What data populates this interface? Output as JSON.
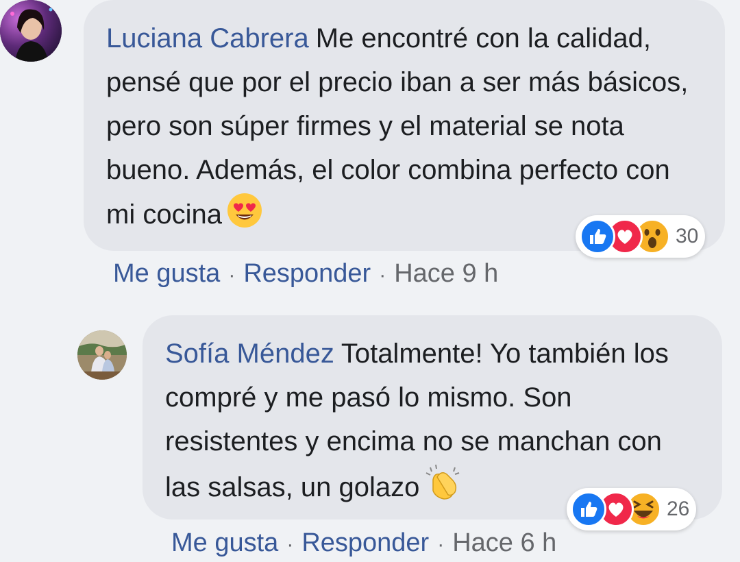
{
  "comments": [
    {
      "author": "Luciana Cabrera",
      "text": "Me encontré con la calidad, pensé que por el precio iban a ser más básicos, pero son súper firmes y el material se nota bueno. Además, el color combina perfecto con mi cocina",
      "inline_emoji": "heart-eyes-emoji",
      "reactions": [
        "like",
        "love",
        "wow"
      ],
      "reaction_count": "30",
      "actions": {
        "like": "Me gusta",
        "reply": "Responder",
        "separator": "·",
        "time": "Hace 9 h"
      }
    },
    {
      "author": "Sofía Méndez",
      "text": "Totalmente! Yo también los compré y me pasó lo mismo. Son resistentes y encima no se manchan con las salsas, un golazo",
      "inline_emoji": "clapping-hands-emoji",
      "reactions": [
        "like",
        "love",
        "haha"
      ],
      "reaction_count": "26",
      "actions": {
        "like": "Me gusta",
        "reply": "Responder",
        "separator": "·",
        "time": "Hace 6 h"
      }
    }
  ],
  "colors": {
    "background": "#f0f2f5",
    "bubble": "#e4e6eb",
    "author": "#385898",
    "text": "#1c1e21",
    "meta": "#65676b",
    "like_blue": "#1877f2",
    "love_red": "#f0284a",
    "emoji_yellow": "#f7b125"
  }
}
